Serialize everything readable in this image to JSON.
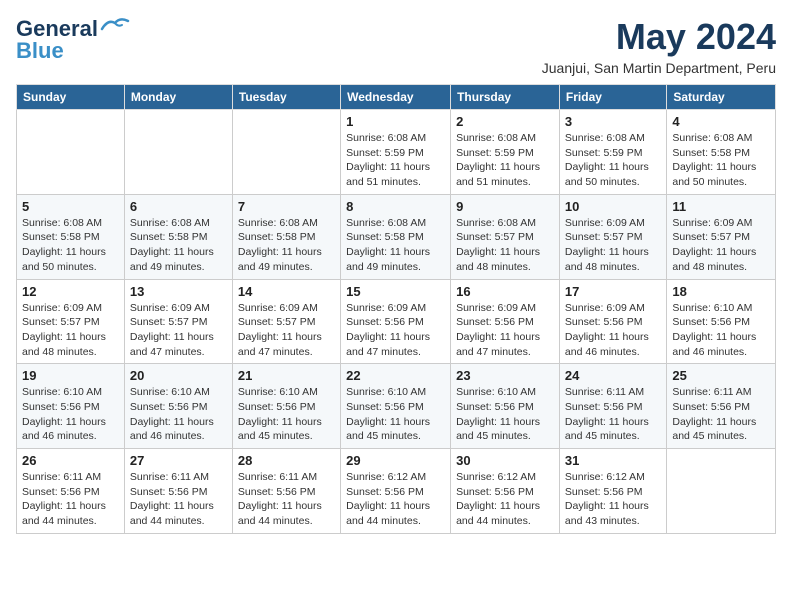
{
  "logo": {
    "line1": "General",
    "line2": "Blue"
  },
  "title": "May 2024",
  "subtitle": "Juanjui, San Martin Department, Peru",
  "weekdays": [
    "Sunday",
    "Monday",
    "Tuesday",
    "Wednesday",
    "Thursday",
    "Friday",
    "Saturday"
  ],
  "weeks": [
    [
      {
        "day": "",
        "info": ""
      },
      {
        "day": "",
        "info": ""
      },
      {
        "day": "",
        "info": ""
      },
      {
        "day": "1",
        "info": "Sunrise: 6:08 AM\nSunset: 5:59 PM\nDaylight: 11 hours and 51 minutes."
      },
      {
        "day": "2",
        "info": "Sunrise: 6:08 AM\nSunset: 5:59 PM\nDaylight: 11 hours and 51 minutes."
      },
      {
        "day": "3",
        "info": "Sunrise: 6:08 AM\nSunset: 5:59 PM\nDaylight: 11 hours and 50 minutes."
      },
      {
        "day": "4",
        "info": "Sunrise: 6:08 AM\nSunset: 5:58 PM\nDaylight: 11 hours and 50 minutes."
      }
    ],
    [
      {
        "day": "5",
        "info": "Sunrise: 6:08 AM\nSunset: 5:58 PM\nDaylight: 11 hours and 50 minutes."
      },
      {
        "day": "6",
        "info": "Sunrise: 6:08 AM\nSunset: 5:58 PM\nDaylight: 11 hours and 49 minutes."
      },
      {
        "day": "7",
        "info": "Sunrise: 6:08 AM\nSunset: 5:58 PM\nDaylight: 11 hours and 49 minutes."
      },
      {
        "day": "8",
        "info": "Sunrise: 6:08 AM\nSunset: 5:58 PM\nDaylight: 11 hours and 49 minutes."
      },
      {
        "day": "9",
        "info": "Sunrise: 6:08 AM\nSunset: 5:57 PM\nDaylight: 11 hours and 48 minutes."
      },
      {
        "day": "10",
        "info": "Sunrise: 6:09 AM\nSunset: 5:57 PM\nDaylight: 11 hours and 48 minutes."
      },
      {
        "day": "11",
        "info": "Sunrise: 6:09 AM\nSunset: 5:57 PM\nDaylight: 11 hours and 48 minutes."
      }
    ],
    [
      {
        "day": "12",
        "info": "Sunrise: 6:09 AM\nSunset: 5:57 PM\nDaylight: 11 hours and 48 minutes."
      },
      {
        "day": "13",
        "info": "Sunrise: 6:09 AM\nSunset: 5:57 PM\nDaylight: 11 hours and 47 minutes."
      },
      {
        "day": "14",
        "info": "Sunrise: 6:09 AM\nSunset: 5:57 PM\nDaylight: 11 hours and 47 minutes."
      },
      {
        "day": "15",
        "info": "Sunrise: 6:09 AM\nSunset: 5:56 PM\nDaylight: 11 hours and 47 minutes."
      },
      {
        "day": "16",
        "info": "Sunrise: 6:09 AM\nSunset: 5:56 PM\nDaylight: 11 hours and 47 minutes."
      },
      {
        "day": "17",
        "info": "Sunrise: 6:09 AM\nSunset: 5:56 PM\nDaylight: 11 hours and 46 minutes."
      },
      {
        "day": "18",
        "info": "Sunrise: 6:10 AM\nSunset: 5:56 PM\nDaylight: 11 hours and 46 minutes."
      }
    ],
    [
      {
        "day": "19",
        "info": "Sunrise: 6:10 AM\nSunset: 5:56 PM\nDaylight: 11 hours and 46 minutes."
      },
      {
        "day": "20",
        "info": "Sunrise: 6:10 AM\nSunset: 5:56 PM\nDaylight: 11 hours and 46 minutes."
      },
      {
        "day": "21",
        "info": "Sunrise: 6:10 AM\nSunset: 5:56 PM\nDaylight: 11 hours and 45 minutes."
      },
      {
        "day": "22",
        "info": "Sunrise: 6:10 AM\nSunset: 5:56 PM\nDaylight: 11 hours and 45 minutes."
      },
      {
        "day": "23",
        "info": "Sunrise: 6:10 AM\nSunset: 5:56 PM\nDaylight: 11 hours and 45 minutes."
      },
      {
        "day": "24",
        "info": "Sunrise: 6:11 AM\nSunset: 5:56 PM\nDaylight: 11 hours and 45 minutes."
      },
      {
        "day": "25",
        "info": "Sunrise: 6:11 AM\nSunset: 5:56 PM\nDaylight: 11 hours and 45 minutes."
      }
    ],
    [
      {
        "day": "26",
        "info": "Sunrise: 6:11 AM\nSunset: 5:56 PM\nDaylight: 11 hours and 44 minutes."
      },
      {
        "day": "27",
        "info": "Sunrise: 6:11 AM\nSunset: 5:56 PM\nDaylight: 11 hours and 44 minutes."
      },
      {
        "day": "28",
        "info": "Sunrise: 6:11 AM\nSunset: 5:56 PM\nDaylight: 11 hours and 44 minutes."
      },
      {
        "day": "29",
        "info": "Sunrise: 6:12 AM\nSunset: 5:56 PM\nDaylight: 11 hours and 44 minutes."
      },
      {
        "day": "30",
        "info": "Sunrise: 6:12 AM\nSunset: 5:56 PM\nDaylight: 11 hours and 44 minutes."
      },
      {
        "day": "31",
        "info": "Sunrise: 6:12 AM\nSunset: 5:56 PM\nDaylight: 11 hours and 43 minutes."
      },
      {
        "day": "",
        "info": ""
      }
    ]
  ]
}
